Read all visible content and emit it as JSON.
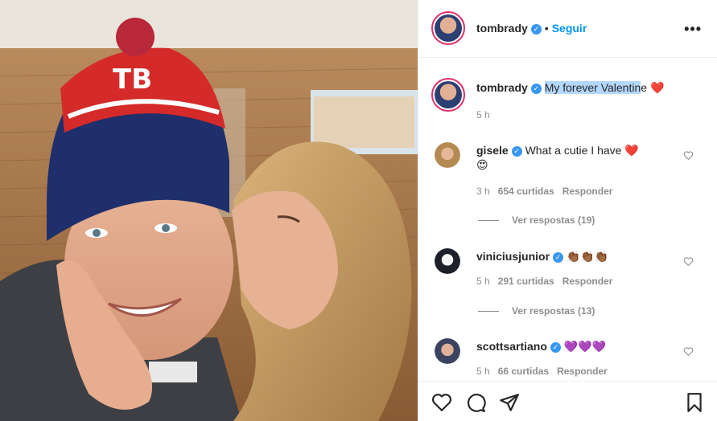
{
  "header": {
    "username": "tombrady",
    "separator": "•",
    "follow_label": "Seguir",
    "more_label": "•••",
    "verified_mark": "✓"
  },
  "caption": {
    "username": "tombrady",
    "text_selected": "My forever Valentin",
    "text_rest": "e",
    "emoji": "❤️",
    "time": "5 h"
  },
  "comments": [
    {
      "username": "gisele",
      "text": "What a cutie I have ❤️",
      "text_line2": "😍",
      "time": "3 h",
      "likes": "654 curtidas",
      "reply_label": "Responder",
      "view_replies": "Ver respostas (19)"
    },
    {
      "username": "viniciusjunior",
      "text": "👏🏾👏🏾👏🏾",
      "time": "5 h",
      "likes": "291 curtidas",
      "reply_label": "Responder",
      "view_replies": "Ver respostas (13)"
    },
    {
      "username": "scottsartiano",
      "text": "💜💜💜",
      "time": "5 h",
      "likes": "66 curtidas",
      "reply_label": "Responder"
    }
  ],
  "actions": {
    "icons": [
      "heart-icon",
      "comment-icon",
      "share-icon",
      "bookmark-icon"
    ]
  },
  "colors": {
    "accent_blue": "#0095f6",
    "verified_blue": "#3897f0",
    "selection": "#b4d7fd",
    "muted": "#8e8e8e",
    "border": "#efefef"
  }
}
